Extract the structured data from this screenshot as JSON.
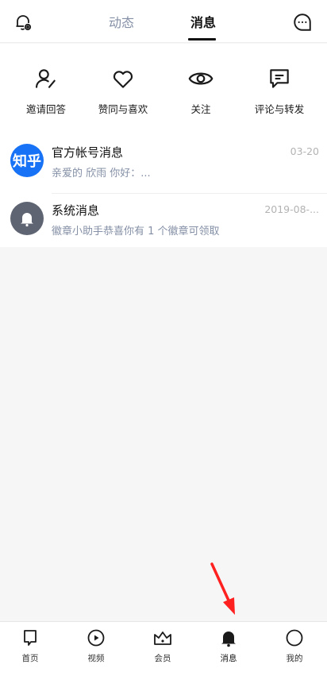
{
  "header": {
    "tab_dynamic": "动态",
    "tab_messages": "消息",
    "left_icon": "bell-settings-icon",
    "right_icon": "chat-bubble-icon"
  },
  "quick_actions": [
    {
      "label": "邀请回答",
      "icon": "user-pen-icon"
    },
    {
      "label": "赞同与喜欢",
      "icon": "heart-icon"
    },
    {
      "label": "关注",
      "icon": "eye-icon"
    },
    {
      "label": "评论与转发",
      "icon": "comment-icon"
    }
  ],
  "messages": [
    {
      "title": "官方帐号消息",
      "preview": "亲爱的 欣雨 你好：...",
      "time": "03-20",
      "avatar_text": "知乎",
      "avatar_color": "#1772f6"
    },
    {
      "title": "系统消息",
      "preview": "徽章小助手恭喜你有 1 个徽章可领取",
      "time": "2019-08-...",
      "avatar_icon": "bell-icon",
      "avatar_color": "#5e6472"
    }
  ],
  "bottom_nav": [
    {
      "label": "首页",
      "icon": "home-flag-icon"
    },
    {
      "label": "视频",
      "icon": "play-circle-icon"
    },
    {
      "label": "会员",
      "icon": "crown-icon"
    },
    {
      "label": "消息",
      "icon": "bell-icon",
      "active": true
    },
    {
      "label": "我的",
      "icon": "profile-circle-icon"
    }
  ],
  "colors": {
    "accent": "#1772f6",
    "annotation_arrow": "#ff2020"
  }
}
